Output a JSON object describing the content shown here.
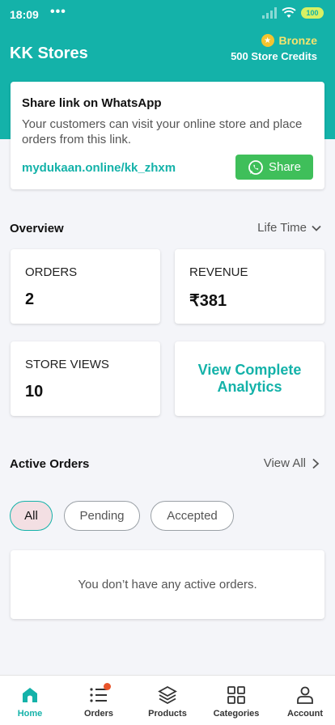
{
  "status_bar": {
    "time": "18:09",
    "dots": "•••",
    "battery": "100"
  },
  "header": {
    "store_name": "KK Stores",
    "tier": "Bronze",
    "credits": "500 Store Credits"
  },
  "share_card": {
    "title": "Share link on WhatsApp",
    "description": "Your customers can visit your online store and place orders from this link.",
    "link": "mydukaan.online/kk_zhxm",
    "button_label": "Share"
  },
  "overview": {
    "title": "Overview",
    "period": "Life Time",
    "stats": [
      {
        "label": "ORDERS",
        "value": "2"
      },
      {
        "label": "REVENUE",
        "value": "₹381"
      },
      {
        "label": "STORE VIEWS",
        "value": "10"
      }
    ],
    "analytics_link": "View Complete Analytics"
  },
  "active_orders": {
    "title": "Active Orders",
    "view_all": "View All",
    "filters": [
      "All",
      "Pending",
      "Accepted"
    ],
    "selected_filter": "All",
    "empty_message": "You don’t have any active orders."
  },
  "bottom_nav": [
    {
      "label": "Home",
      "icon": "home-icon",
      "active": true
    },
    {
      "label": "Orders",
      "icon": "list-icon",
      "badge": true
    },
    {
      "label": "Products",
      "icon": "layers-icon"
    },
    {
      "label": "Categories",
      "icon": "grid-icon"
    },
    {
      "label": "Account",
      "icon": "user-icon"
    }
  ],
  "colors": {
    "primary": "#14b2a9",
    "whatsapp": "#3fbf5a",
    "tier": "#f5e46e",
    "badge": "#e8542a"
  }
}
